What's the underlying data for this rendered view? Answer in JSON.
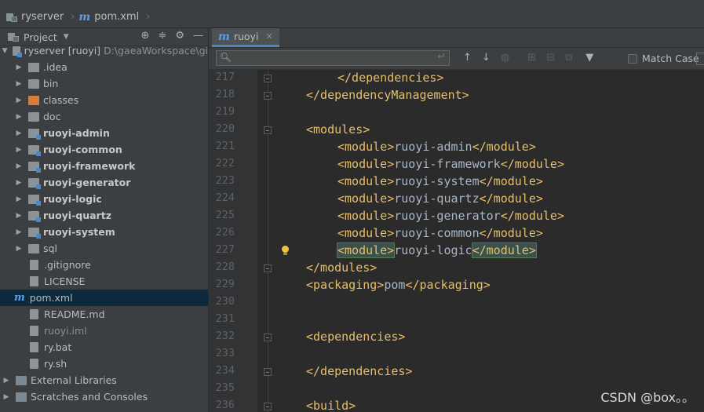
{
  "breadcrumb": {
    "project": "ryserver",
    "file": "pom.xml"
  },
  "project_panel": {
    "title": "Project",
    "tree": [
      {
        "label": "ryserver [ruoyi]",
        "path": "D:\\gaeaWorkspace\\gi",
        "type": "module-root",
        "expanded": true
      },
      {
        "label": ".idea",
        "type": "folder"
      },
      {
        "label": "bin",
        "type": "folder"
      },
      {
        "label": "classes",
        "type": "folder-excluded"
      },
      {
        "label": "doc",
        "type": "folder"
      },
      {
        "label": "ruoyi-admin",
        "type": "module"
      },
      {
        "label": "ruoyi-common",
        "type": "module"
      },
      {
        "label": "ruoyi-framework",
        "type": "module"
      },
      {
        "label": "ruoyi-generator",
        "type": "module"
      },
      {
        "label": "ruoyi-logic",
        "type": "module"
      },
      {
        "label": "ruoyi-quartz",
        "type": "module"
      },
      {
        "label": "ruoyi-system",
        "type": "module"
      },
      {
        "label": "sql",
        "type": "folder"
      },
      {
        "label": ".gitignore",
        "type": "file"
      },
      {
        "label": "LICENSE",
        "type": "file"
      },
      {
        "label": "pom.xml",
        "type": "maven",
        "selected": true
      },
      {
        "label": "README.md",
        "type": "file"
      },
      {
        "label": "ruoyi.iml",
        "type": "file-dim"
      },
      {
        "label": "ry.bat",
        "type": "file"
      },
      {
        "label": "ry.sh",
        "type": "file"
      },
      {
        "label": "External Libraries",
        "type": "libraries"
      },
      {
        "label": "Scratches and Consoles",
        "type": "scratches"
      }
    ]
  },
  "editor": {
    "tab_label": "ruoyi",
    "find": {
      "query": "",
      "match_case_label": "Match Case",
      "match_case_checked": false
    },
    "lines": [
      {
        "n": "217",
        "indent": 2,
        "code": "</dependencies>"
      },
      {
        "n": "218",
        "indent": 1,
        "code": "</dependencyManagement>"
      },
      {
        "n": "219",
        "indent": 0,
        "code": ""
      },
      {
        "n": "220",
        "indent": 1,
        "code": "<modules>"
      },
      {
        "n": "221",
        "indent": 2,
        "code": "<module>ruoyi-admin</module>"
      },
      {
        "n": "222",
        "indent": 2,
        "code": "<module>ruoyi-framework</module>"
      },
      {
        "n": "223",
        "indent": 2,
        "code": "<module>ruoyi-system</module>"
      },
      {
        "n": "224",
        "indent": 2,
        "code": "<module>ruoyi-quartz</module>"
      },
      {
        "n": "225",
        "indent": 2,
        "code": "<module>ruoyi-generator</module>"
      },
      {
        "n": "226",
        "indent": 2,
        "code": "<module>ruoyi-common</module>"
      },
      {
        "n": "227",
        "indent": 2,
        "code": "<module>ruoyi-logic</module>"
      },
      {
        "n": "228",
        "indent": 1,
        "code": "</modules>"
      },
      {
        "n": "229",
        "indent": 1,
        "code": "<packaging>pom</packaging>"
      },
      {
        "n": "230",
        "indent": 0,
        "code": ""
      },
      {
        "n": "231",
        "indent": 0,
        "code": ""
      },
      {
        "n": "232",
        "indent": 1,
        "code": "<dependencies>"
      },
      {
        "n": "233",
        "indent": 0,
        "code": ""
      },
      {
        "n": "234",
        "indent": 1,
        "code": "</dependencies>"
      },
      {
        "n": "235",
        "indent": 0,
        "code": ""
      },
      {
        "n": "236",
        "indent": 1,
        "code": "<build>"
      }
    ]
  },
  "watermark": "CSDN @box。。",
  "colors": {
    "tag": "#e8bf6a",
    "text": "#a9b7c6",
    "selection": "#0d293e",
    "accent": "#4a88c7"
  }
}
